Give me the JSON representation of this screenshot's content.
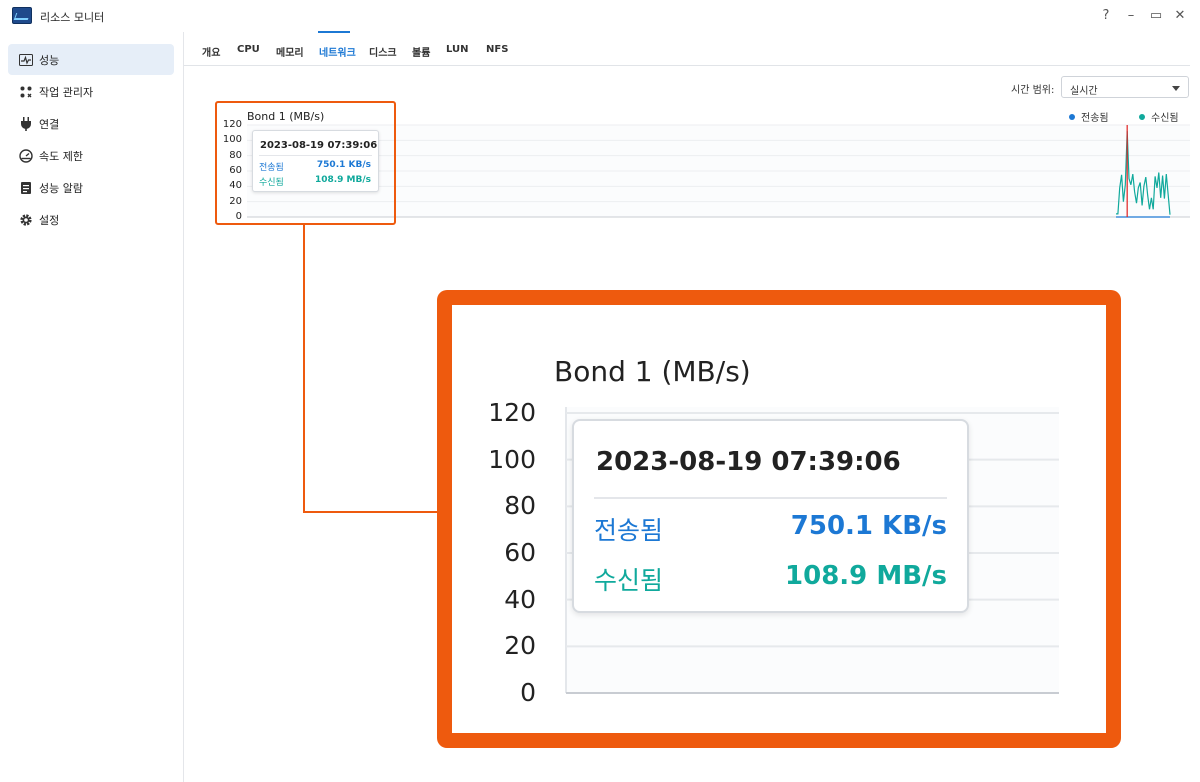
{
  "window": {
    "title": "리소스 모니터",
    "help": "?",
    "minimize": "–",
    "maximize": "▭",
    "close": "✕"
  },
  "sidebar": {
    "items": [
      {
        "label": "성능",
        "icon": "performance-icon",
        "active": true
      },
      {
        "label": "작업 관리자",
        "icon": "task-manager-icon"
      },
      {
        "label": "연결",
        "icon": "plug-icon"
      },
      {
        "label": "속도 제한",
        "icon": "speed-gauge-icon"
      },
      {
        "label": "성능 알람",
        "icon": "clipboard-icon"
      },
      {
        "label": "설정",
        "icon": "gear-icon"
      }
    ]
  },
  "tabs": [
    "개요",
    "CPU",
    "메모리",
    "네트워크",
    "디스크",
    "볼륨",
    "LUN",
    "NFS"
  ],
  "active_tab": "네트워크",
  "time_range": {
    "label": "시간 범위:",
    "value": "실시간"
  },
  "legend": [
    {
      "name": "전송됨",
      "color": "#1c78d4"
    },
    {
      "name": "수신됨",
      "color": "#10a99c"
    }
  ],
  "chart_data": {
    "type": "line",
    "title": "Bond 1 (MB/s)",
    "ylim": [
      0,
      120
    ],
    "yticks": [
      "120",
      "100",
      "80",
      "60",
      "40",
      "20",
      "0"
    ],
    "grid": true,
    "legend_position": "top-right",
    "series": [
      {
        "name": "전송됨",
        "color": "#1c78d4",
        "values": [
          0,
          0,
          0,
          0,
          0,
          0,
          0,
          0,
          0,
          0,
          0,
          0,
          0,
          0,
          0,
          0,
          0,
          0,
          0,
          0,
          0,
          0,
          0,
          0,
          0,
          0,
          0,
          0,
          0,
          0
        ]
      },
      {
        "name": "수신됨",
        "color": "#10a99c",
        "values": [
          4,
          4,
          38,
          55,
          20,
          42,
          112,
          50,
          42,
          56,
          33,
          18,
          38,
          45,
          15,
          40,
          52,
          28,
          10,
          25,
          10,
          53,
          38,
          58,
          25,
          54,
          24,
          56,
          30,
          3
        ]
      }
    ],
    "cursor_index": 6,
    "cursor_color": "#e02020"
  },
  "tooltip": {
    "time": "2023-08-19 07:39:06",
    "sent_label": "전송됨",
    "sent_value": "750.1 KB/s",
    "recv_label": "수신됨",
    "recv_value": "108.9 MB/s"
  },
  "highlight_color": "#ee5a0e"
}
